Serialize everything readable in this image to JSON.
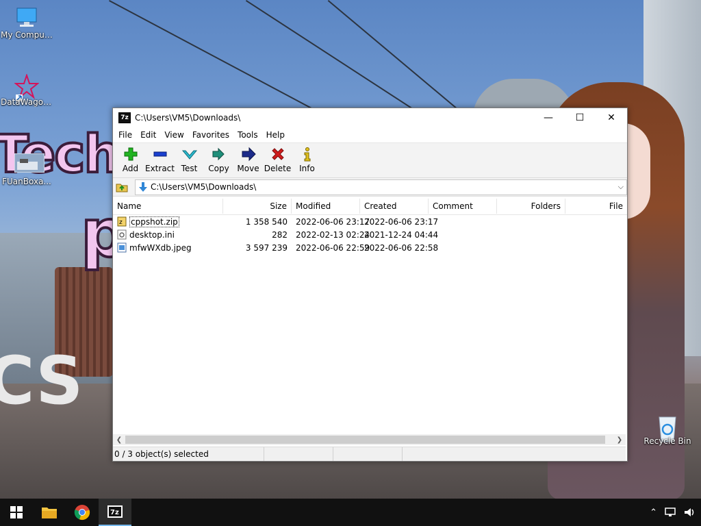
{
  "desktop": {
    "icons": [
      {
        "label": "My Computer"
      },
      {
        "label": "DataWagon..."
      },
      {
        "label": "FUanBoxa..."
      },
      {
        "label": "Recycle Bin"
      }
    ],
    "wallpaper_text": {
      "top": "Tech",
      "middle": "p",
      "bottom": "CS"
    }
  },
  "window": {
    "app_icon_text": "7z",
    "title": "C:\\Users\\VM5\\Downloads\\",
    "controls": {
      "minimize": "—",
      "maximize": "☐",
      "close": "✕"
    },
    "menu": [
      "File",
      "Edit",
      "View",
      "Favorites",
      "Tools",
      "Help"
    ],
    "toolbar": [
      {
        "label": "Add",
        "icon": "plus-icon",
        "color": "#21b321"
      },
      {
        "label": "Extract",
        "icon": "minus-icon",
        "color": "#1a3fcf"
      },
      {
        "label": "Test",
        "icon": "check-icon",
        "color": "#2bbbd0"
      },
      {
        "label": "Copy",
        "icon": "double-arrow-icon",
        "color": "#1f8f7a"
      },
      {
        "label": "Move",
        "icon": "arrow-right-icon",
        "color": "#1c2b8a"
      },
      {
        "label": "Delete",
        "icon": "x-icon",
        "color": "#d01c1c"
      },
      {
        "label": "Info",
        "icon": "info-icon",
        "color": "#e0c020"
      }
    ],
    "address": "C:\\Users\\VM5\\Downloads\\",
    "columns": [
      "Name",
      "Size",
      "Modified",
      "Created",
      "Comment",
      "Folders",
      "File"
    ],
    "files": [
      {
        "name": "cppshot.zip",
        "size": "1 358 540",
        "modified": "2022-06-06 23:17",
        "created": "2022-06-06 23:17",
        "type": "zip"
      },
      {
        "name": "desktop.ini",
        "size": "282",
        "modified": "2022-02-13 02:24",
        "created": "2021-12-24 04:44",
        "type": "ini"
      },
      {
        "name": "mfwWXdb.jpeg",
        "size": "3 597 239",
        "modified": "2022-06-06 22:59",
        "created": "2022-06-06 22:58",
        "type": "image"
      }
    ],
    "status": "0 / 3 object(s) selected"
  },
  "taskbar": {
    "items": [
      "start-icon",
      "file-explorer-icon",
      "chrome-icon",
      "7zip-icon"
    ],
    "active": "7zip-icon"
  }
}
